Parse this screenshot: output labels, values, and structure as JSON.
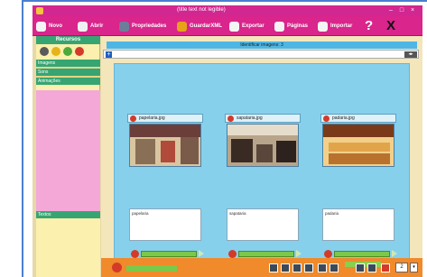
{
  "window": {
    "title": "(title text not legible)",
    "minimize": "–",
    "maximize": "□",
    "close": "×"
  },
  "toolbar": {
    "items": [
      {
        "label": "Novo",
        "icon": "new-page-icon",
        "color": "#f4f4f4"
      },
      {
        "label": "Abrir",
        "icon": "open-icon",
        "color": "#f1f1f1"
      },
      {
        "label": "Propriedades",
        "icon": "properties-icon",
        "color": "#6c7f9a"
      },
      {
        "label": "GuardarXML",
        "icon": "save-xml-icon",
        "color": "#e7a21a"
      },
      {
        "label": "Exportar",
        "icon": "export-icon",
        "color": "#f4f4f4"
      },
      {
        "label": "Páginas",
        "icon": "pages-icon",
        "color": "#f4f4f4"
      },
      {
        "label": "Importar",
        "icon": "import-icon",
        "color": "#f4f4f4"
      }
    ],
    "help": "?",
    "close": "X"
  },
  "sidebar": {
    "header": "Recursos",
    "tools": [
      {
        "icon": "tools-icon",
        "color": "#5a5a5a"
      },
      {
        "icon": "wand-icon",
        "color": "#e7b21a"
      },
      {
        "icon": "add-green-icon",
        "color": "#4caa3a"
      },
      {
        "icon": "delete-red-icon",
        "color": "#d43a2a"
      }
    ],
    "items": [
      "Imagens",
      "Sons",
      "Animações"
    ],
    "text_section": "Textos"
  },
  "main": {
    "screen_title": "Identificar imagens: 3",
    "add_symbol": "+",
    "nav_symbol": "◂▸",
    "cards": [
      {
        "filename": "papelaria.jpg",
        "caption": "papelaria",
        "palette": [
          "#6c3e3a",
          "#d9c5a0",
          "#8a6f57"
        ]
      },
      {
        "filename": "sapataria.jpg",
        "caption": "sapataria",
        "palette": [
          "#3a2a24",
          "#b8a48a",
          "#e6dccb"
        ]
      },
      {
        "filename": "padaria.jpg",
        "caption": "padaria",
        "palette": [
          "#7a3a1a",
          "#e2a44a",
          "#f3d08a"
        ]
      }
    ]
  },
  "bottom": {
    "page_number": "2",
    "dropdown": "▾",
    "buttons": [
      "save-icon",
      "list-icon",
      "grid-icon",
      "copy-icon",
      "first-page-icon",
      "prev-page-icon",
      "next-page-icon",
      "last-page-icon",
      "delete-page-icon"
    ]
  }
}
